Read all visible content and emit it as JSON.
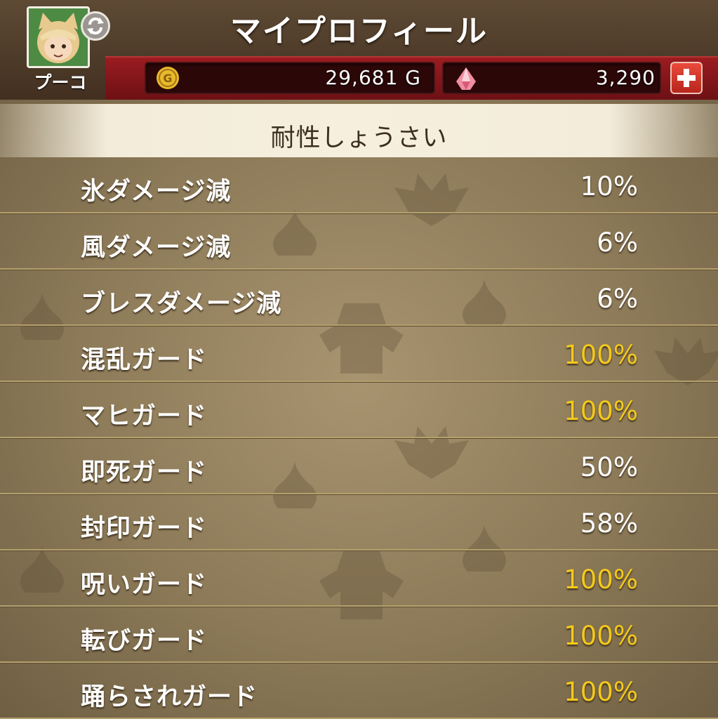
{
  "header": {
    "title": "マイプロフィール",
    "player_name": "プーコ",
    "gold": "29,681 G",
    "gems": "3,290"
  },
  "section_title": "耐性しょうさい",
  "resistances": [
    {
      "label": "氷ダメージ減",
      "value": "10%",
      "maxed": false
    },
    {
      "label": "風ダメージ減",
      "value": "6%",
      "maxed": false
    },
    {
      "label": "ブレスダメージ減",
      "value": "6%",
      "maxed": false
    },
    {
      "label": "混乱ガード",
      "value": "100%",
      "maxed": true
    },
    {
      "label": "マヒガード",
      "value": "100%",
      "maxed": true
    },
    {
      "label": "即死ガード",
      "value": "50%",
      "maxed": false
    },
    {
      "label": "封印ガード",
      "value": "58%",
      "maxed": false
    },
    {
      "label": "呪いガード",
      "value": "100%",
      "maxed": true
    },
    {
      "label": "転びガード",
      "value": "100%",
      "maxed": true
    },
    {
      "label": "踊らされガード",
      "value": "100%",
      "maxed": true
    }
  ],
  "colors": {
    "header_bg": "#4e3c2a",
    "currency_band": "#8c1a1e",
    "value_white": "#ffffff",
    "value_max": "#f3c91c"
  },
  "icons": [
    "swap-icon",
    "gold-coin-icon",
    "gem-icon",
    "plus-icon"
  ]
}
